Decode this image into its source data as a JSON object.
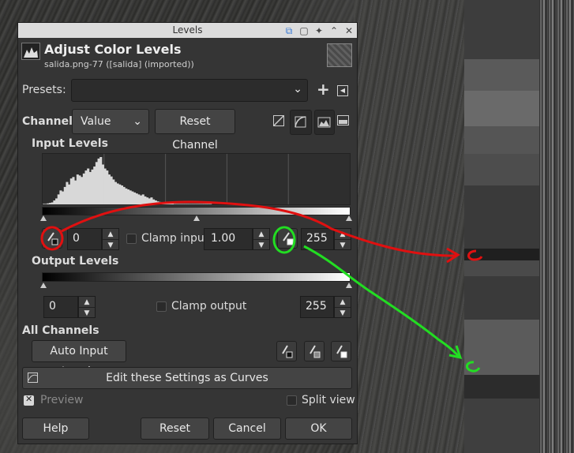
{
  "dialog": {
    "window_title": "Levels",
    "title": "Adjust Color Levels",
    "subtitle": "salida.png-77 ([salida] (imported))",
    "titlebar_icons": [
      "pin-icon",
      "maximize-icon",
      "sticky-icon",
      "collapse-icon",
      "close-icon"
    ]
  },
  "presets": {
    "label": "Presets:",
    "value": ""
  },
  "channel": {
    "label": "Channel:",
    "value": "Value",
    "reset_label": "Reset Channel"
  },
  "input_levels": {
    "label": "Input Levels",
    "low": "0",
    "gamma": "1.00",
    "high": "255",
    "clamp_label": "Clamp input",
    "histogram": [
      1,
      1,
      2,
      3,
      4,
      8,
      12,
      20,
      28,
      26,
      35,
      45,
      40,
      52,
      55,
      48,
      60,
      58,
      55,
      62,
      68,
      72,
      65,
      70,
      76,
      85,
      92,
      95,
      80,
      72,
      68,
      60,
      56,
      50,
      45,
      42,
      40,
      38,
      35,
      32,
      30,
      28,
      26,
      24,
      22,
      20,
      18,
      20,
      16,
      14,
      12,
      14,
      10,
      8,
      6,
      5,
      4,
      4,
      3,
      3,
      2,
      2,
      1,
      1,
      1,
      1,
      1,
      1,
      1,
      1,
      1,
      1,
      1,
      1,
      1,
      1,
      1,
      1,
      1,
      1
    ]
  },
  "output_levels": {
    "label": "Output Levels",
    "low": "0",
    "high": "255",
    "clamp_label": "Clamp output"
  },
  "all_channels": {
    "label": "All Channels",
    "auto_label": "Auto Input Levels"
  },
  "curves_label": "Edit these Settings as Curves",
  "preview_label": "Preview",
  "split_label": "Split view",
  "buttons": {
    "help": "Help",
    "reset": "Reset",
    "cancel": "Cancel",
    "ok": "OK"
  },
  "colors": {
    "annotation_red": "#e01010",
    "annotation_green": "#22dd22",
    "dialog_bg": "#353535"
  }
}
